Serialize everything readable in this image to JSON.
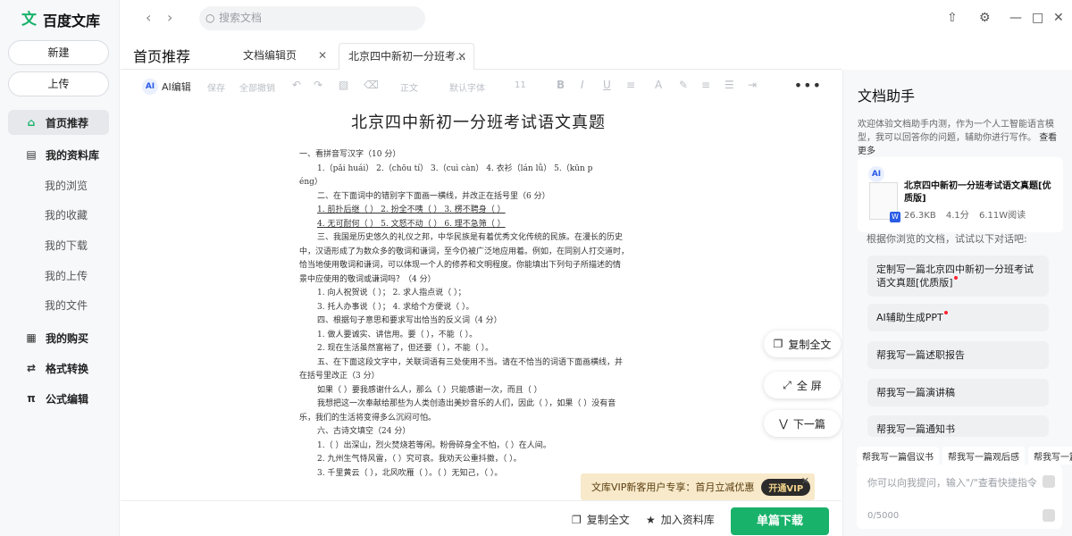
{
  "app": {
    "logo_mark": "文",
    "logo_text": "百度文库"
  },
  "sidebar": {
    "new_btn": "新建",
    "upload_btn": "上传",
    "items": [
      {
        "icon": "⌂",
        "label": "首页推荐"
      },
      {
        "icon": "▤",
        "label": "我的资料库"
      },
      {
        "icon": "▦",
        "label": "我的购买"
      },
      {
        "icon": "⇄",
        "label": "格式转换"
      },
      {
        "icon": "π",
        "label": "公式编辑"
      }
    ],
    "sub_items": [
      "我的浏览",
      "我的收藏",
      "我的下载",
      "我的上传",
      "我的文件"
    ]
  },
  "topbar": {
    "search_placeholder": "搜索文档",
    "back": "‹",
    "forward": "›"
  },
  "tabs": {
    "page_title": "首页推荐",
    "items": [
      {
        "label": "文档编辑页",
        "close": "✕"
      },
      {
        "label": "北京四中新初一分班考...",
        "close": "✕"
      }
    ]
  },
  "toolbar": {
    "ai_badge": "AI",
    "ai_label": "AI编辑",
    "save": "保存",
    "undo_all": "全部撤销",
    "style": "正文",
    "font": "默认字体",
    "size": "11",
    "bold": "B",
    "italic": "I",
    "underline": "U",
    "more": "•••"
  },
  "document": {
    "title": "北京四中新初一分班考试语文真题",
    "lines": [
      "一、看拼音写汉字（10 分）",
      "1.（pǎi huái） 2.（chōu tí） 3.（cuì càn） 4. 衣衫（lán lǚ） 5.（kūn p",
      "éng）",
      "二、在下面词中的错别字下面画一横线，并改正在括号里（6 分）",
      "1. 前扑后继（ ） 2. 扮全不咦（ ） 3. 楞不聘身（ ）",
      "4. 无可耐何（ ） 5. 文怒不动（ ） 6. 理不急筛（ ）",
      "三、我国是历史悠久的礼仪之邦，中华民族是有着优秀文化传统的民族。在漫长的历史",
      "中，汉语形成了为数众多的敬词和谦词，至今仍被广泛地应用着。例如，在同别人打交道时，",
      "恰当地使用敬词和谦词，可以体现一个人的修养和文明程度。你能填出下列句子所描述的情",
      "景中应使用的敬词或谦词吗？（4 分）",
      "1. 向人祝贺说（ ）； 2. 求人指点说（ ）；",
      "3. 托人办事说（ ）； 4. 求给个方便说（ ）。",
      "四、根据句子意思和要求写出恰当的反义词（4 分）",
      "1. 做人要诚实、讲信用。要（ ），不能（ ）。",
      "2. 现在生活虽然富裕了，但还要（ ），不能（ ）。",
      "五、在下面这段文字中，关联词语有三处使用不当。请在不恰当的词语下面画横线，并",
      "在括号里改正（3 分）",
      "如果（ ）要我感谢什么人，那么（ ）只能感谢一次，而且（ ）",
      "我想把这一次奉献给那些为人类创造出美妙音乐的人们，因此（ ），如果（ ）没有音",
      "乐，我们的生活将变得多么沉闷可怕。",
      "六、古诗文填空（24 分）",
      "1.（ ）出深山，烈火焚烧若等闲。粉骨碎身全不怕，（ ）在人间。",
      "2. 九州生气恃风雷，（ ）究可哀。我劝天公重抖擞，（ ）。",
      "3. 千里黄云（ ），北风吹雁（ ）。（ ）无知己，（ ）。"
    ]
  },
  "float_buttons": {
    "copy_all": "复制全文",
    "fullscreen": "全 屏",
    "next": "下一篇"
  },
  "vip_banner": {
    "text": "文库VIP新客用户专享：首月立减优惠",
    "button": "开通VIP",
    "close": "✕"
  },
  "bottom_bar": {
    "copy_all": "复制全文",
    "add_library": "加入资料库",
    "download": "单篇下载"
  },
  "assistant": {
    "title": "文档助手",
    "description": "欢迎体验文档助手内测，作为一个人工智能语言模型，我可以回答你的问题，辅助你进行写作。",
    "more_link": "查看更多",
    "doc_card": {
      "badge": "AI",
      "title": "北京四中新初一分班考试语文真题[优质版]",
      "file_badge": "W",
      "size": "26.3KB",
      "rating": "4.1分",
      "reads": "6.11W阅读"
    },
    "hint": "根据你浏览的文档，试试以下对话吧:",
    "suggestions": [
      "定制写一篇北京四中新初一分班考试语文真题[优质版]",
      "AI辅助生成PPT",
      "帮我写一篇述职报告",
      "帮我写一篇演讲稿",
      "帮我写一篇通知书"
    ],
    "chips": [
      "帮我写一篇倡议书",
      "帮我写一篇观后感",
      "帮我写一篇"
    ],
    "input_placeholder": "你可以向我提问，输入\"/\"查看快捷指令",
    "char_count": "0/5000"
  }
}
